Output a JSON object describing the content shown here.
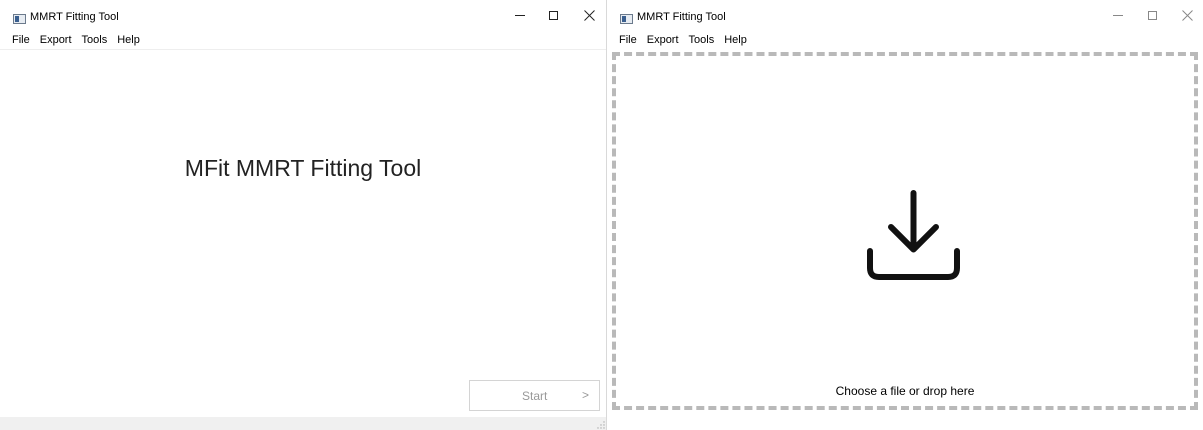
{
  "windows": [
    {
      "title": "MMRT Fitting Tool",
      "menu": [
        "File",
        "Export",
        "Tools",
        "Help"
      ],
      "heading": "MFit MMRT Fitting Tool",
      "start_button": {
        "label": "Start",
        "chevron": ">"
      },
      "icons": [
        "app-icon",
        "minimize-icon",
        "maximize-icon",
        "close-icon",
        "size-grip-icon"
      ]
    },
    {
      "title": "MMRT Fitting Tool",
      "menu": [
        "File",
        "Export",
        "Tools",
        "Help"
      ],
      "dropzone": {
        "text": "Choose a file or drop here",
        "icon": "download-icon"
      },
      "icons": [
        "app-icon",
        "minimize-icon",
        "maximize-icon",
        "close-icon"
      ]
    }
  ],
  "colors": {
    "dropzone_border": "#b9b9b9",
    "status_bar": "#f0f0f0",
    "disabled_text": "#999999",
    "button_border": "#d4d4d4"
  }
}
